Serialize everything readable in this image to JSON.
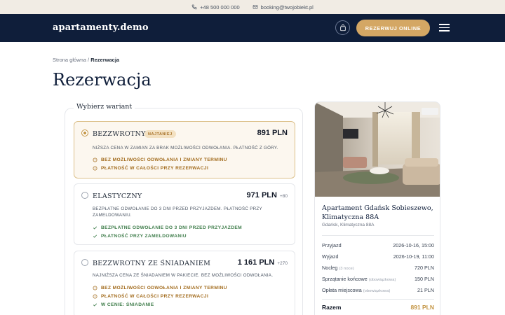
{
  "topbar": {
    "phone": "+48 500 000 000",
    "email": "booking@twojobiekt.pl",
    "phone_icon": "phone-icon",
    "email_icon": "mail-icon"
  },
  "nav": {
    "logo": "apartamenty.demo",
    "cart_icon": "shopping-bag-icon",
    "cta_label": "REZERWUJ ONLINE",
    "menu_icon": "hamburger-icon"
  },
  "breadcrumb": {
    "home": "Strona główna",
    "separator": " / ",
    "current": "Rezerwacja"
  },
  "page_title": "Rezerwacja",
  "variants": {
    "legend": "Wybierz wariant",
    "options": [
      {
        "name": "BEZZWROTNY",
        "badge": "NAJTANIEJ",
        "price": "891 PLN",
        "delta": "",
        "selected": true,
        "description": "NIŻSZA CENA W ZAMIAN ZA BRAK MOŻLIWOŚCI ODWOŁANIA. PŁATNOŚĆ Z GÓRY.",
        "features": [
          {
            "text": "BEZ MOŻLIWOŚCI ODWOŁANIA I ZMIANY TERMINU",
            "kind": "warn"
          },
          {
            "text": "PŁATNOŚĆ W CAŁOŚCI PRZY REZERWACJI",
            "kind": "warn"
          }
        ]
      },
      {
        "name": "ELASTYCZNY",
        "badge": "",
        "price": "971 PLN",
        "delta": "+80",
        "selected": false,
        "description": "BEZPŁATNE ODWOŁANIE DO 3 DNI PRZED PRZYJAZDEM. PŁATNOŚĆ PRZY ZAMELDOWANIU.",
        "features": [
          {
            "text": "BEZPŁATNE ODWOŁANIE DO 3 DNI PRZED PRZYJAZDEM",
            "kind": "ok"
          },
          {
            "text": "PŁATNOŚĆ PRZY ZAMELDOWANIU",
            "kind": "ok"
          }
        ]
      },
      {
        "name": "BEZZWROTNY ZE ŚNIADANIEM",
        "badge": "",
        "price": "1 161 PLN",
        "delta": "+270",
        "selected": false,
        "description": "NAJNIŻSZA CENA ZE ŚNIADANIEM W PAKIECIE. BEZ MOŻLIWOŚCI ODWOŁANIA.",
        "features": [
          {
            "text": "BEZ MOŻLIWOŚCI ODWOŁANIA I ZMIANY TERMINU",
            "kind": "warn"
          },
          {
            "text": "PŁATNOŚĆ W CAŁOŚCI PRZY REZERWACJI",
            "kind": "warn"
          },
          {
            "text": "W CENIE: ŚNIADANIE",
            "kind": "ok"
          }
        ]
      }
    ]
  },
  "summary": {
    "name": "Apartament Gdańsk Sobieszewo, Klimatyczna 88A",
    "address": "Gdańsk, Klimatyczna 88A",
    "rows": [
      {
        "label": "Przyjazd",
        "note": "",
        "value": "2026-10-16, 15:00"
      },
      {
        "label": "Wyjazd",
        "note": "",
        "value": "2026-10-19, 11:00"
      },
      {
        "label": "Nocleg",
        "note": "(3 noce)",
        "value": "720 PLN"
      },
      {
        "label": "Sprzątanie końcowe",
        "note": "(obowiązkowa)",
        "value": "150 PLN"
      },
      {
        "label": "Opłata miejscowa",
        "note": "(obowiązkowa)",
        "value": "21 PLN"
      }
    ],
    "total_label": "Razem",
    "total_value": "891 PLN"
  },
  "colors": {
    "navy": "#0f1e3a",
    "gold": "#d4a764",
    "warn": "#a26b1c",
    "ok": "#3f7d4b"
  }
}
